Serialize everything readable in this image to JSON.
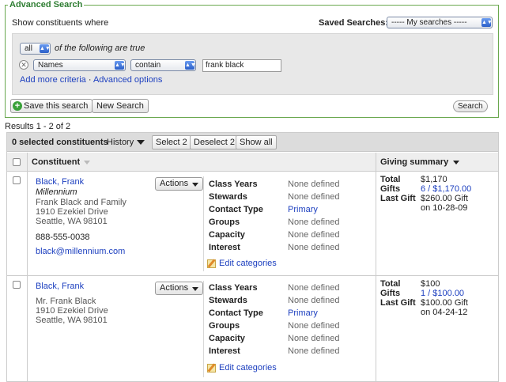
{
  "search": {
    "legend": "Advanced Search",
    "show_where": "Show constituents where",
    "saved_label": "Saved Searches:",
    "saved_value": "----- My searches -----",
    "match_value": "all",
    "match_text": "of the following are true",
    "criteria": {
      "field": "Names",
      "operator": "contain",
      "value": "frank black"
    },
    "add_more": "Add more criteria",
    "separator": "·",
    "advanced_options": "Advanced options",
    "save_label": "Save this search",
    "new_label": "New Search",
    "search_label": "Search"
  },
  "results": {
    "count_text": "Results 1 - 2 of 2",
    "selected_text": "0 selected constituents",
    "history_label": "History",
    "select_btn": "Select 2",
    "deselect_btn": "Deselect 2",
    "showall_btn": "Show all",
    "col_constituent": "Constituent",
    "col_giving": "Giving summary",
    "actions_label": "Actions",
    "edit_categories": "Edit categories",
    "attr_labels": [
      "Class Years",
      "Stewards",
      "Contact Type",
      "Groups",
      "Capacity",
      "Interest"
    ],
    "giving_labels": [
      "Total",
      "Gifts",
      "Last Gift"
    ],
    "rows": [
      {
        "name": "Black, Frank",
        "org": "Millennium",
        "addr1": "Frank Black and Family",
        "addr2": "1910 Ezekiel Drive",
        "addr3": "Seattle, WA 98101",
        "phone": "888-555-0038",
        "email": "black@millennium.com",
        "attrs": [
          "None defined",
          "None defined",
          "Primary",
          "None defined",
          "None defined",
          "None defined"
        ],
        "total": "$1,170",
        "gifts": "6 / $1,170.00",
        "last_gift_1": "$260.00 Gift",
        "last_gift_2": "on 10-28-09"
      },
      {
        "name": "Black, Frank",
        "addr1": "Mr. Frank Black",
        "addr2": "1910 Ezekiel Drive",
        "addr3": "Seattle, WA 98101",
        "attrs": [
          "None defined",
          "None defined",
          "Primary",
          "None defined",
          "None defined",
          "None defined"
        ],
        "total": "$100",
        "gifts": "1 / $100.00",
        "last_gift_1": "$100.00 Gift",
        "last_gift_2": "on 04-24-12"
      }
    ]
  },
  "colors": {
    "accent_green": "#2e7d32",
    "link_blue": "#1c3fbf"
  }
}
